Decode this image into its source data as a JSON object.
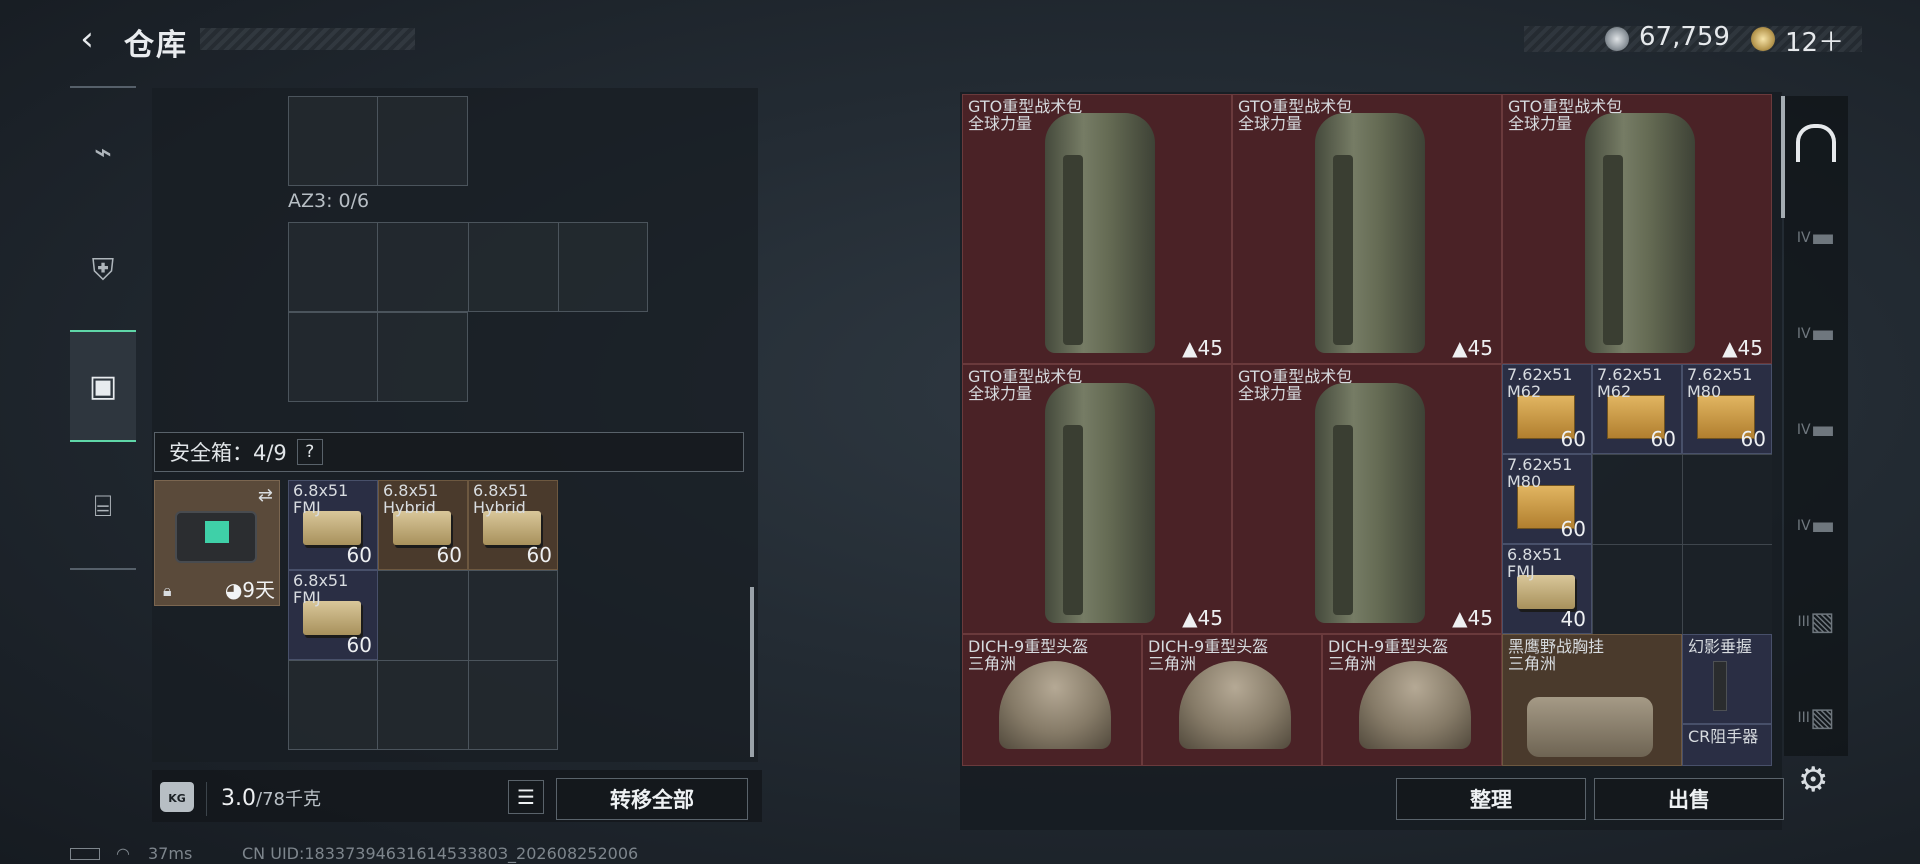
{
  "header": {
    "back_icon": "back-arrow-icon",
    "title": "仓库",
    "currency1": "67,759",
    "currency2": "12＋"
  },
  "nav": {
    "items": [
      {
        "icon": "pistol-icon"
      },
      {
        "icon": "armor-icon"
      },
      {
        "icon": "backpack-icon"
      },
      {
        "icon": "toolbox-icon"
      }
    ],
    "active": 2
  },
  "left": {
    "az3_label": "AZ3: 0/6",
    "safebox_label": "安全箱：4/9",
    "help": "?",
    "case_timer": "9天",
    "items": [
      {
        "label": "6.8x51\nFMJ",
        "count": "60"
      },
      {
        "label": "6.8x51\nHybrid",
        "count": "60"
      },
      {
        "label": "6.8x51\nHybrid",
        "count": "60"
      },
      {
        "label": "6.8x51\nFMJ",
        "count": "60"
      }
    ],
    "weight": "3.0",
    "weight_max": "/78千克",
    "transfer_all": "转移全部"
  },
  "right": {
    "backpacks": [
      {
        "name": "GTO重型战术包",
        "brand": "全球力量",
        "count": "45"
      },
      {
        "name": "GTO重型战术包",
        "brand": "全球力量",
        "count": "45"
      },
      {
        "name": "GTO重型战术包",
        "brand": "全球力量",
        "count": "45"
      },
      {
        "name": "GTO重型战术包",
        "brand": "全球力量",
        "count": "45"
      },
      {
        "name": "GTO重型战术包",
        "brand": "全球力量",
        "count": "45"
      }
    ],
    "ammo": [
      {
        "label": "7.62x51\nM62",
        "count": "60"
      },
      {
        "label": "7.62x51\nM62",
        "count": "60"
      },
      {
        "label": "7.62x51\nM80",
        "count": "60"
      },
      {
        "label": "7.62x51\nM80",
        "count": "60"
      },
      {
        "label": "6.8x51\nFMJ",
        "count": "40"
      }
    ],
    "helmets": [
      {
        "name": "DICH-9重型头盔",
        "brand": "三角洲"
      },
      {
        "name": "DICH-9重型头盔",
        "brand": "三角洲"
      },
      {
        "name": "DICH-9重型头盔",
        "brand": "三角洲"
      }
    ],
    "vest": {
      "name": "黑鹰野战胸挂",
      "brand": "三角洲"
    },
    "grip": "幻影垂握",
    "cr": "CR阻手器",
    "sort_button": "整理",
    "sell_button": "出售",
    "side_tabs": [
      "IV",
      "IV",
      "IV",
      "IV",
      "III",
      "III"
    ]
  },
  "status": {
    "ping": "37ms",
    "uid": "CN UID:1833739463161453380З_202608252006"
  }
}
